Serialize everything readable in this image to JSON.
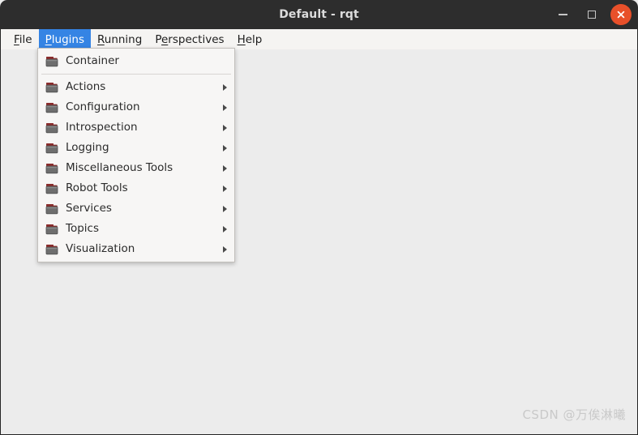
{
  "window": {
    "title": "Default - rqt",
    "buttons": {
      "minimize": "minimize",
      "maximize": "maximize",
      "close": "close"
    },
    "colors": {
      "titlebar_bg": "#2d2d2d",
      "title_text": "#dcdcdc",
      "close_button": "#e8502a",
      "menu_highlight": "#3584e4",
      "client_bg": "#ececec",
      "popup_bg": "#f7f6f5",
      "folder_icon_body": "#6e6e6e",
      "folder_icon_tab": "#8a2c2c"
    }
  },
  "menubar": {
    "items": [
      {
        "label": "File",
        "accel_index": 0,
        "active": false
      },
      {
        "label": "Plugins",
        "accel_index": 0,
        "active": true
      },
      {
        "label": "Running",
        "accel_index": 0,
        "active": false
      },
      {
        "label": "Perspectives",
        "accel_index": 1,
        "active": false
      },
      {
        "label": "Help",
        "accel_index": 0,
        "active": false
      }
    ]
  },
  "plugins_menu": {
    "items": [
      {
        "label": "Container",
        "icon": "folder-icon",
        "submenu": false,
        "separator_after": true
      },
      {
        "label": "Actions",
        "icon": "folder-icon",
        "submenu": true,
        "separator_after": false
      },
      {
        "label": "Configuration",
        "icon": "folder-icon",
        "submenu": true,
        "separator_after": false
      },
      {
        "label": "Introspection",
        "icon": "folder-icon",
        "submenu": true,
        "separator_after": false
      },
      {
        "label": "Logging",
        "icon": "folder-icon",
        "submenu": true,
        "separator_after": false
      },
      {
        "label": "Miscellaneous Tools",
        "icon": "folder-icon",
        "submenu": true,
        "separator_after": false
      },
      {
        "label": "Robot Tools",
        "icon": "folder-icon",
        "submenu": true,
        "separator_after": false
      },
      {
        "label": "Services",
        "icon": "folder-icon",
        "submenu": true,
        "separator_after": false
      },
      {
        "label": "Topics",
        "icon": "folder-icon",
        "submenu": true,
        "separator_after": false
      },
      {
        "label": "Visualization",
        "icon": "folder-icon",
        "submenu": true,
        "separator_after": false
      }
    ]
  },
  "client": {
    "watermark": "CSDN @万俟淋曦"
  }
}
